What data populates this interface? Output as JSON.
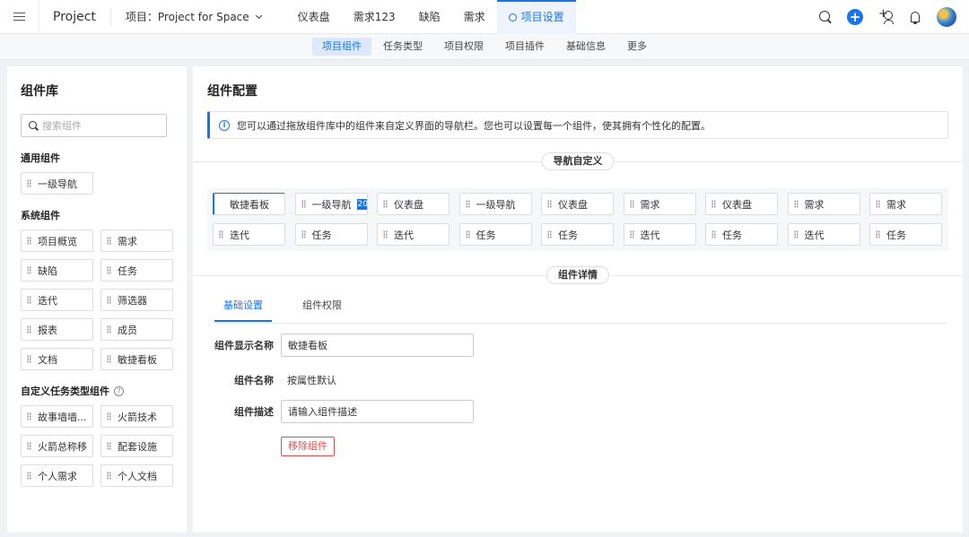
{
  "header": {
    "app_name": "Project",
    "project_label": "项目：Project for Space",
    "nav_tabs": [
      {
        "label": "仪表盘"
      },
      {
        "label": "需求123"
      },
      {
        "label": "缺陷"
      },
      {
        "label": "需求"
      },
      {
        "label": "项目设置"
      }
    ],
    "active_tab": "项目设置",
    "accent_color": "#1b73e8"
  },
  "subnav": {
    "tabs": [
      {
        "label": "项目组件"
      },
      {
        "label": "任务类型"
      },
      {
        "label": "项目权限"
      },
      {
        "label": "项目插件"
      },
      {
        "label": "基础信息"
      },
      {
        "label": "更多"
      }
    ],
    "active": "项目组件"
  },
  "library": {
    "title": "组件库",
    "search_placeholder": "搜索组件",
    "groups": [
      {
        "title": "通用组件",
        "items": [
          "一级导航"
        ]
      },
      {
        "title": "系统组件",
        "items": [
          "项目概览",
          "需求",
          "缺陷",
          "任务",
          "迭代",
          "筛选器",
          "报表",
          "成员",
          "文档",
          "敏捷看板"
        ]
      },
      {
        "title": "自定义任务类型组件",
        "items": [
          "故事墙墙...",
          "火箭技术",
          "火箭总称移",
          "配套设施",
          "个人需求",
          "个人文档"
        ]
      }
    ]
  },
  "config": {
    "title": "组件配置",
    "info_text": "您可以通过拖放组件库中的组件来自定义界面的导航栏。您也可以设置每一个组件，使其拥有个性化的配置。",
    "nav_section_label": "导航自定义",
    "nav_items": [
      {
        "label": "敏捷看板"
      },
      {
        "label": "一级导航",
        "badge": "20"
      },
      {
        "label": "仪表盘"
      },
      {
        "label": "一级导航"
      },
      {
        "label": "仪表盘"
      },
      {
        "label": "需求"
      },
      {
        "label": "仪表盘"
      },
      {
        "label": "需求"
      },
      {
        "label": "需求"
      },
      {
        "label": "迭代"
      },
      {
        "label": "任务"
      },
      {
        "label": "迭代"
      },
      {
        "label": "任务"
      },
      {
        "label": "任务"
      },
      {
        "label": "迭代"
      },
      {
        "label": "任务"
      },
      {
        "label": "迭代"
      },
      {
        "label": "任务"
      }
    ],
    "detail_section_label": "组件详情",
    "detail_tabs": [
      {
        "label": "基础设置"
      },
      {
        "label": "组件权限"
      }
    ],
    "form": {
      "display_name_label": "组件显示名称",
      "display_name_value": "敏捷看板",
      "name_label": "组件名称",
      "name_value": "按属性默认",
      "desc_label": "组件描述",
      "desc_value": "请输入组件描述"
    },
    "remove_label": "移除组件"
  }
}
